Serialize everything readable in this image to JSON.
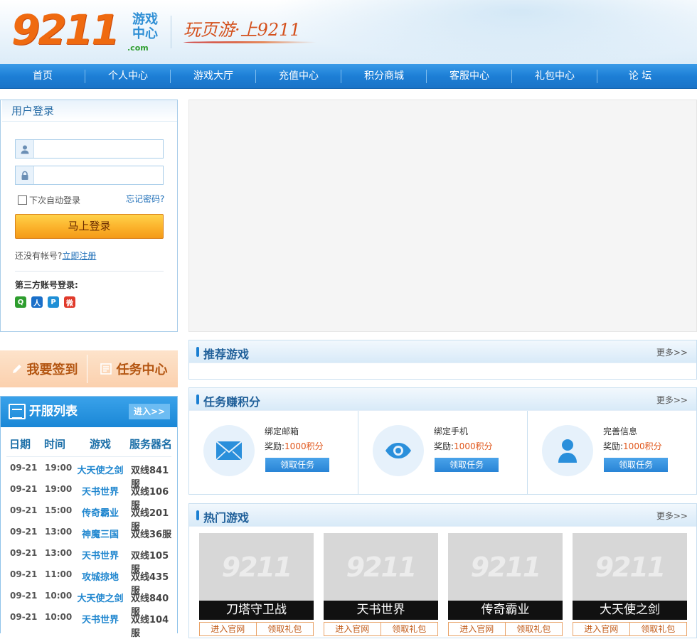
{
  "header": {
    "logo_number": "9211",
    "logo_cn_top": "游戏",
    "logo_cn_bottom": "中心",
    "logo_domain": ".com",
    "slogan": "玩页游·上9211"
  },
  "nav": {
    "items": [
      "首页",
      "个人中心",
      "游戏大厅",
      "充值中心",
      "积分商城",
      "客服中心",
      "礼包中心",
      "论 坛"
    ]
  },
  "login": {
    "title": "用户登录",
    "username_placeholder": "",
    "password_placeholder": "",
    "remember_label": "下次自动登录",
    "forgot_label": "忘记密码?",
    "login_button": "马上登录",
    "no_account": "还没有帐号?",
    "register_link": "立即注册",
    "third_party_label": "第三方账号登录:",
    "social_icons": [
      {
        "icon": "qq-icon",
        "color": "#2e9d2e"
      },
      {
        "icon": "renren-icon",
        "color": "#1a6fc9"
      },
      {
        "icon": "tencent-weibo-icon",
        "color": "#1f8fd6"
      },
      {
        "icon": "sina-weibo-icon",
        "color": "#e03a2b"
      }
    ]
  },
  "signbar": {
    "sign_label": "我要签到",
    "task_label": "任务中心"
  },
  "server_list": {
    "title": "开服列表",
    "enter_label": "进入>>",
    "headers": [
      "日期",
      "时间",
      "游戏",
      "服务器名"
    ],
    "rows": [
      {
        "date": "09-21",
        "time": "19:00",
        "game": "大天使之剑",
        "server": "双线841服"
      },
      {
        "date": "09-21",
        "time": "19:00",
        "game": "天书世界",
        "server": "双线106服"
      },
      {
        "date": "09-21",
        "time": "15:00",
        "game": "传奇霸业",
        "server": "双线201服"
      },
      {
        "date": "09-21",
        "time": "13:00",
        "game": "神魔三国",
        "server": "双线36服"
      },
      {
        "date": "09-21",
        "time": "13:00",
        "game": "天书世界",
        "server": "双线105服"
      },
      {
        "date": "09-21",
        "time": "11:00",
        "game": "攻城掠地",
        "server": "双线435服"
      },
      {
        "date": "09-21",
        "time": "10:00",
        "game": "大天使之剑",
        "server": "双线840服"
      },
      {
        "date": "09-21",
        "time": "10:00",
        "game": "天书世界",
        "server": "双线104服"
      }
    ]
  },
  "recommended": {
    "title": "推荐游戏",
    "more": "更多>>"
  },
  "tasks": {
    "title": "任务赚积分",
    "more": "更多>>",
    "items": [
      {
        "name": "绑定邮箱",
        "reward_prefix": "奖励:",
        "reward": "1000积分",
        "button": "领取任务",
        "icon": "envelope-icon"
      },
      {
        "name": "绑定手机",
        "reward_prefix": "奖励:",
        "reward": "1000积分",
        "button": "领取任务",
        "icon": "eye-icon"
      },
      {
        "name": "完善信息",
        "reward_prefix": "奖励:",
        "reward": "1000积分",
        "button": "领取任务",
        "icon": "user-icon"
      }
    ]
  },
  "hot_games": {
    "title": "热门游戏",
    "more": "更多>>",
    "items": [
      {
        "name": "刀塔守卫战",
        "thumb_text": "9211",
        "official": "进入官网",
        "gift": "领取礼包"
      },
      {
        "name": "天书世界",
        "thumb_text": "9211",
        "official": "进入官网",
        "gift": "领取礼包"
      },
      {
        "name": "传奇霸业",
        "thumb_text": "9211",
        "official": "进入官网",
        "gift": "领取礼包"
      },
      {
        "name": "大天使之剑",
        "thumb_text": "9211",
        "official": "进入官网",
        "gift": "领取礼包"
      }
    ]
  }
}
